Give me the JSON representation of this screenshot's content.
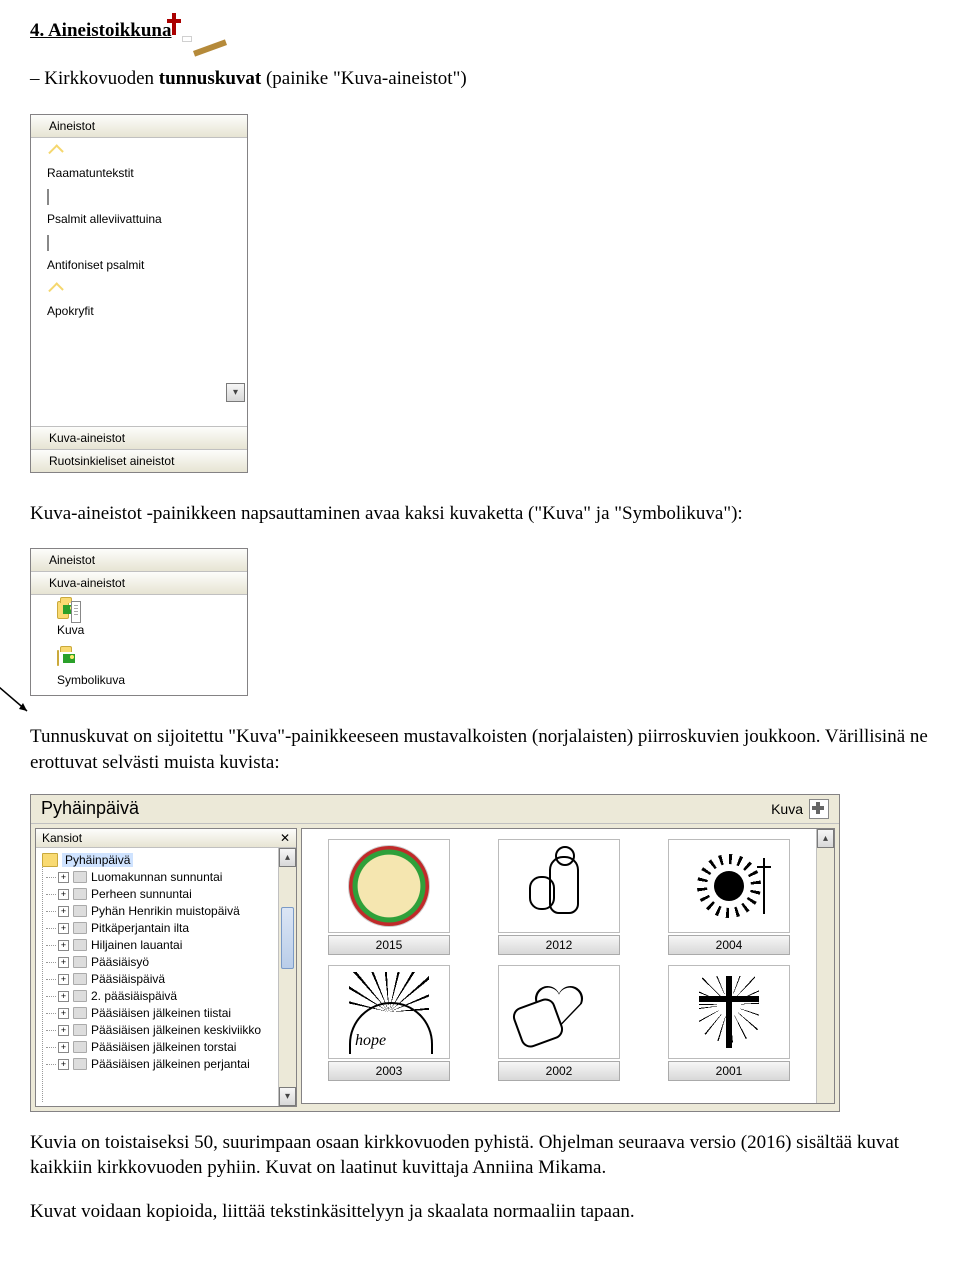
{
  "section_title": "4. Aineistoikkuna",
  "p1_before": "Kirkkovuoden ",
  "p1_bold": "tunnuskuvat",
  "p1_after": " (painike \"Kuva-aineistot\")",
  "panel1": {
    "header": "Aineistot",
    "items": [
      "Raamatuntekstit",
      "Psalmit alleviivattuina",
      "Antifoniset psalmit",
      "Apokryfit"
    ],
    "footer1": "Kuva-aineistot",
    "footer2": "Ruotsinkieliset aineistot"
  },
  "p2": "Kuva-aineistot -painikkeen napsauttaminen avaa kaksi kuvaketta (\"Kuva\" ja \"Symbolikuva\"):",
  "panel2": {
    "header": "Aineistot",
    "sub": "Kuva-aineistot",
    "items": [
      "Kuva",
      "Symbolikuva"
    ]
  },
  "p3": "Tunnuskuvat on sijoitettu \"Kuva\"-painikkeeseen mustavalkoisten (norjalaisten) piirroskuvien joukkoon. Värillisinä ne erottuvat selvästi muista kuvista:",
  "kuva": {
    "title": "Pyhäinpäivä",
    "rightlabel": "Kuva",
    "tree_header": "Kansiot",
    "close": "✕",
    "root": "Pyhäinpäivä",
    "nodes": [
      "Luomakunnan sunnuntai",
      "Perheen sunnuntai",
      "Pyhän Henrikin muistopäivä",
      "Pitkäperjantain ilta",
      "Hiljainen lauantai",
      "Pääsiäisyö",
      "Pääsiäispäivä",
      "2. pääsiäispäivä",
      "Pääsiäisen jälkeinen tiistai",
      "Pääsiäisen jälkeinen keskiviikko",
      "Pääsiäisen jälkeinen torstai",
      "Pääsiäisen jälkeinen perjantai"
    ],
    "thumbs": [
      "2015",
      "2012",
      "2004",
      "2003",
      "2002",
      "2001"
    ]
  },
  "p4": "Kuvia on toistaiseksi 50, suurimpaan osaan kirkkovuoden pyhistä. Ohjelman seuraava versio (2016) sisältää kuvat kaikkiin kirkkovuoden pyhiin. Kuvat on laatinut kuvittaja Anniina Mikama.",
  "p5": "Kuvat voidaan kopioida, liittää tekstinkäsittelyyn ja skaalata normaaliin tapaan."
}
